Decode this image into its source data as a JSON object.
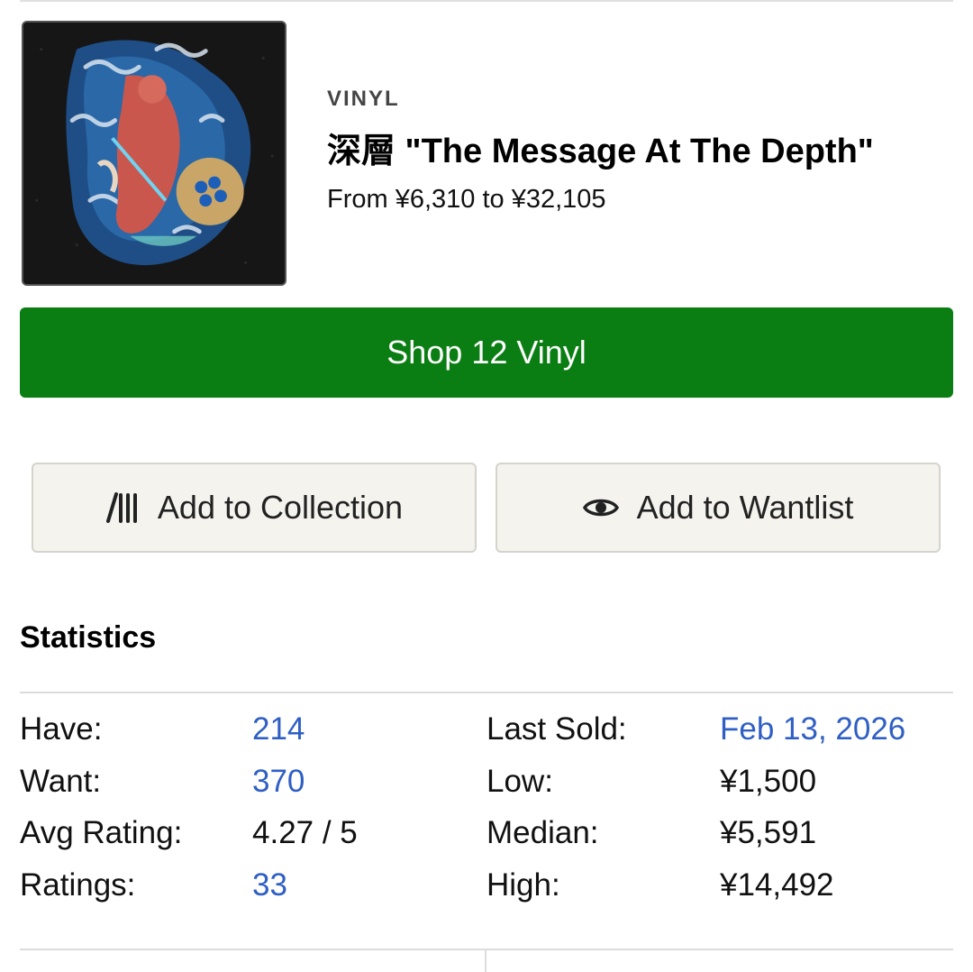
{
  "release": {
    "format": "VINYL",
    "title": "深層 \"The Message At The Depth\"",
    "price_range": "From ¥6,310 to ¥32,105"
  },
  "actions": {
    "shop_label": "Shop 12 Vinyl",
    "collection_label": "Add to Collection",
    "wantlist_label": "Add to Wantlist",
    "collection_icon": "collection-icon",
    "wantlist_icon": "eye-icon"
  },
  "statistics": {
    "heading": "Statistics",
    "left": [
      {
        "label": "Have:",
        "value": "214",
        "link": true
      },
      {
        "label": "Want:",
        "value": "370",
        "link": true
      },
      {
        "label": "Avg Rating:",
        "value": "4.27 / 5",
        "link": false
      },
      {
        "label": "Ratings:",
        "value": "33",
        "link": true
      }
    ],
    "right": [
      {
        "label": "Last Sold:",
        "value": "Feb 13, 2026",
        "link": true
      },
      {
        "label": "Low:",
        "value": "¥1,500",
        "link": false
      },
      {
        "label": "Median:",
        "value": "¥5,591",
        "link": false
      },
      {
        "label": "High:",
        "value": "¥14,492",
        "link": false
      }
    ]
  },
  "colors": {
    "shop_button": "#0a7e12",
    "link": "#2f5fc4",
    "secondary_button_bg": "#f4f3ee"
  }
}
